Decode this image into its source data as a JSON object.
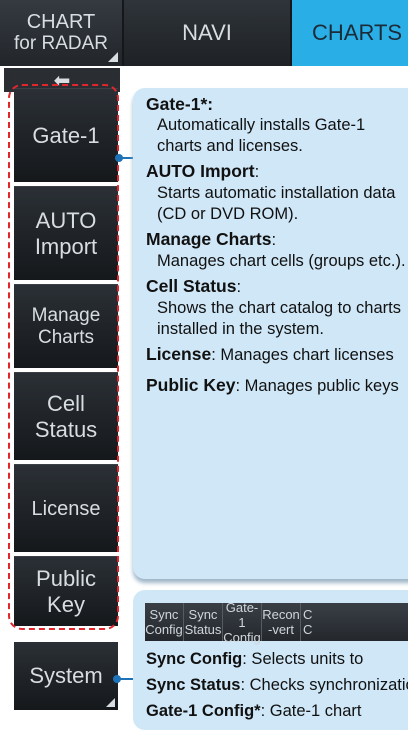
{
  "top_tabs": {
    "chart_for_radar": [
      "CHART",
      "for RADAR"
    ],
    "navi": "NAVI",
    "charts": "CHARTS"
  },
  "sidebar": {
    "back_icon": "arrow-left-icon",
    "buttons": [
      {
        "lines": [
          "Gate-1"
        ]
      },
      {
        "lines": [
          "AUTO",
          "Import"
        ]
      },
      {
        "lines": [
          "Manage",
          "Charts"
        ]
      },
      {
        "lines": [
          "Cell",
          "Status"
        ]
      },
      {
        "lines": [
          "License"
        ]
      },
      {
        "lines": [
          "Public",
          "Key"
        ]
      }
    ],
    "system": "System"
  },
  "info": {
    "gate1_title": "Gate-1*:",
    "gate1_desc": "Automatically installs Gate-1 charts and licenses.",
    "auto_title": "AUTO Import",
    "auto_colon": ":",
    "auto_desc": "Starts automatic installation data (CD or DVD ROM).",
    "manage_title": "Manage Charts",
    "manage_colon": ":",
    "manage_desc": "Manages chart cells (groups etc.).",
    "cell_title": "Cell Status",
    "cell_colon": ":",
    "cell_desc": "Shows the chart catalog to charts installed in the system.",
    "license_title": "License",
    "license_desc": ": Manages chart licenses",
    "pubkey_title": "Public Key",
    "pubkey_desc": ": Manages public keys"
  },
  "mini_bar": [
    {
      "lines": [
        "Sync",
        "Config"
      ]
    },
    {
      "lines": [
        "Sync",
        "Status"
      ]
    },
    {
      "lines": [
        "Gate-1",
        "Config"
      ]
    },
    {
      "lines": [
        "Recon",
        "-vert"
      ]
    },
    {
      "lines": [
        "C",
        "C"
      ]
    }
  ],
  "info2": {
    "sync_config_title": "Sync Config",
    "sync_config_desc": ": Selects units to",
    "sync_status_title": "Sync Status",
    "sync_status_desc": ": Checks synchronization",
    "gate1_config_title": "Gate-1 Config*",
    "gate1_config_desc": ": Gate-1 chart"
  },
  "colors": {
    "accent": "#2aaee6",
    "highlight_dashed": "#e2262b",
    "callout_bg": "#cfe7f7",
    "connector": "#1e73b8"
  }
}
